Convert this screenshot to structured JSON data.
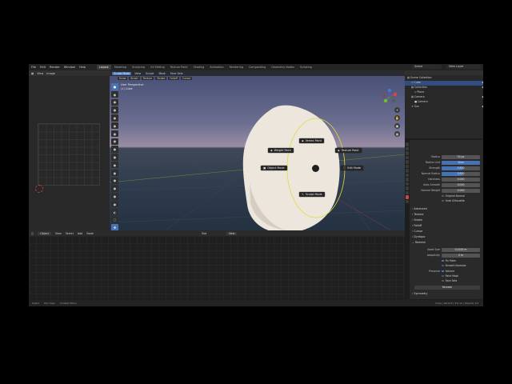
{
  "topbar": {
    "menu": [
      "File",
      "Edit",
      "Render",
      "Window",
      "Help"
    ],
    "workspaces": [
      "Layout",
      "Modeling",
      "Sculpting",
      "UV Editing",
      "Texture Paint",
      "Shading",
      "Animation",
      "Rendering",
      "Compositing",
      "Geometry Nodes",
      "Scripting"
    ],
    "active_workspace": "Layout",
    "scene": "Scene",
    "view_layer": "View Layer"
  },
  "left_editor": {
    "menu": [
      "View",
      "Image"
    ]
  },
  "viewport": {
    "mode": "Sculpt Mode",
    "header": [
      "View",
      "Sculpt",
      "Mask",
      "Face Sets"
    ],
    "brush_label": "Draw",
    "subheader": [
      "Brush",
      "Texture",
      "Stroke",
      "Falloff",
      "Cursor"
    ],
    "info_line1": "User Perspective",
    "info_line2": "(1) Cube",
    "pie_menu": {
      "top": "Vertex Paint",
      "upper_left": "Weight Paint",
      "upper_right": "Texture Paint",
      "left": "Object Mode",
      "right": "Edit Mode",
      "bottom": "Sculpt Mode"
    },
    "colors": {
      "brush_circle": "#e0dd3a",
      "object": "#ece6dc",
      "selected_header": "#4772b3"
    }
  },
  "bottom_editor": {
    "mode": "Object",
    "menu": [
      "View",
      "Select",
      "Add",
      "Node"
    ],
    "slot": "Slot",
    "new_label": "New"
  },
  "outliner": {
    "rows": [
      {
        "label": "Scene Collection"
      },
      {
        "label": "Cube"
      },
      {
        "label": "Collection"
      },
      {
        "label": "Plane"
      },
      {
        "label": "Camera"
      },
      {
        "label": "Camera"
      },
      {
        "label": "Sun"
      }
    ]
  },
  "properties": {
    "rows": [
      {
        "label": "Radius",
        "value": "50 px"
      },
      {
        "label": "Radius Unit",
        "value": "View"
      },
      {
        "label": "Strength",
        "value": "0.500"
      },
      {
        "label": "Normal Radius",
        "value": "0.500"
      },
      {
        "label": "Hardness",
        "value": "0.000"
      },
      {
        "label": "Auto-Smooth",
        "value": "0.000"
      },
      {
        "label": "Normal Weight",
        "value": "0.000"
      }
    ],
    "checks": [
      "Original Normal",
      "Grab Silhouette"
    ],
    "sections": [
      "Advanced",
      "Texture",
      "Stroke",
      "Falloff",
      "Cursor",
      "Symmetry",
      "Options",
      "Remesh"
    ],
    "remesh": {
      "voxel_size_label": "Voxel Size",
      "voxel_size": "0.0100 m",
      "adaptivity_label": "Adaptivity",
      "adaptivity": "0 m",
      "checks": [
        "Fix Poles",
        "Smooth Normals"
      ],
      "preserve_label": "Preserve",
      "preserve": [
        "Volume",
        "Paint Mask",
        "Face Sets"
      ],
      "button": "Remesh"
    },
    "dyntopo": "Dyntopo"
  },
  "statusbar": {
    "left": [
      "Select",
      "Pan View",
      "Context Menu"
    ],
    "right": "Cube | Verts 8 | Tris 12 | Objects 1/3"
  }
}
